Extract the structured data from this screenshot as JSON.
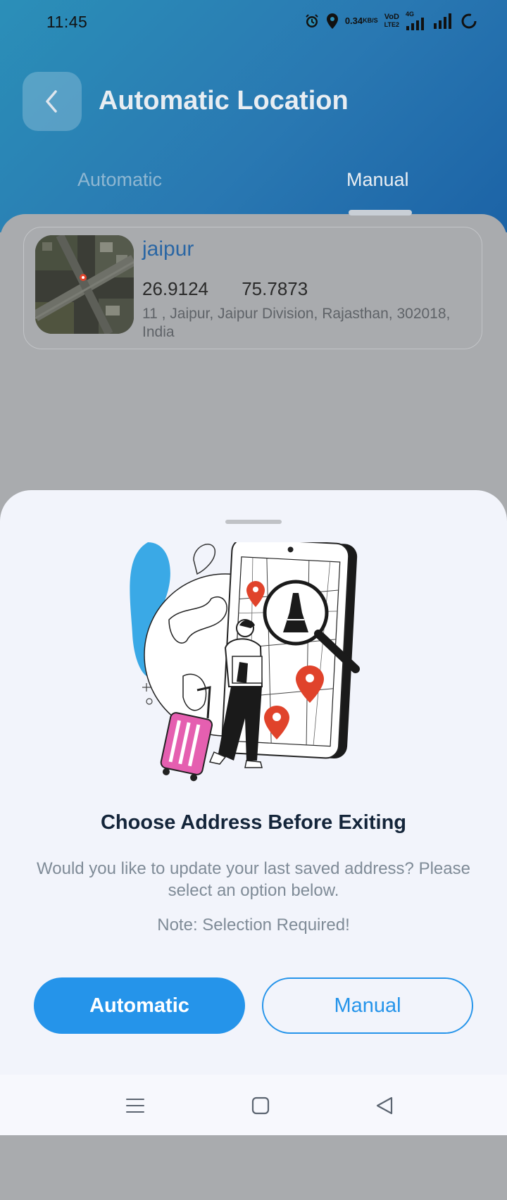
{
  "status_bar": {
    "time": "11:45",
    "speed_value": "0.34",
    "speed_unit": "KB/S",
    "volte_top": "VoD",
    "volte_bottom": "LTE2",
    "network": "4G",
    "icons": [
      "alarm-icon",
      "location-pin-icon",
      "signal-icon",
      "signal-icon",
      "loading-ring-icon"
    ]
  },
  "header": {
    "title": "Automatic Location",
    "back_icon": "chevron-left-icon"
  },
  "tabs": [
    {
      "label": "Automatic",
      "active": false
    },
    {
      "label": "Manual",
      "active": true
    }
  ],
  "location_card": {
    "name": "jaipur",
    "latitude": "26.9124",
    "longitude": "75.7873",
    "address": "11 , Jaipur, Jaipur Division, Rajasthan, 302018, India"
  },
  "sheet": {
    "title": "Choose Address Before Exiting",
    "description": "Would you like to update your last saved address? Please select an option below.",
    "note": "Note: Selection Required!",
    "buttons": {
      "automatic": "Automatic",
      "manual": "Manual"
    }
  },
  "nav_bar": {
    "icons": [
      "menu-icon",
      "home-icon",
      "back-icon"
    ]
  },
  "colors": {
    "header_start": "#2b8fb8",
    "header_end": "#1c63a6",
    "primary_button": "#2594ea",
    "overlay_bg": "#a9abae",
    "sheet_bg": "#f2f4fb",
    "pin_red": "#e0432b",
    "suitcase_pink": "#e55fb0"
  }
}
